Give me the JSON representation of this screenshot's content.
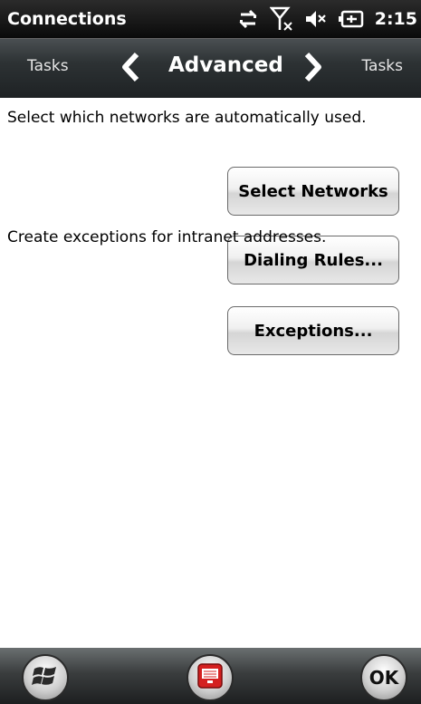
{
  "status_bar": {
    "title": "Connections",
    "time": "2:15",
    "icons": [
      "data-sync-icon",
      "signal-off-icon",
      "volume-muted-icon",
      "battery-charging-icon"
    ]
  },
  "tab_strip": {
    "left_label": "Tasks",
    "current_label": "Advanced",
    "right_label": "Tasks"
  },
  "content": {
    "networks_description": "Select which networks are automatically used.",
    "select_networks_label": "Select Networks",
    "dialing_rules_label": "Dialing Rules...",
    "exceptions_description": "Create exceptions for intranet addresses.",
    "exceptions_label": "Exceptions..."
  },
  "bottom_bar": {
    "start_icon": "windows-logo-icon",
    "input_icon": "keyboard-icon",
    "ok_label": "OK"
  },
  "colors": {
    "input_icon_red": "#d42020",
    "content_background": "#ffffff"
  }
}
